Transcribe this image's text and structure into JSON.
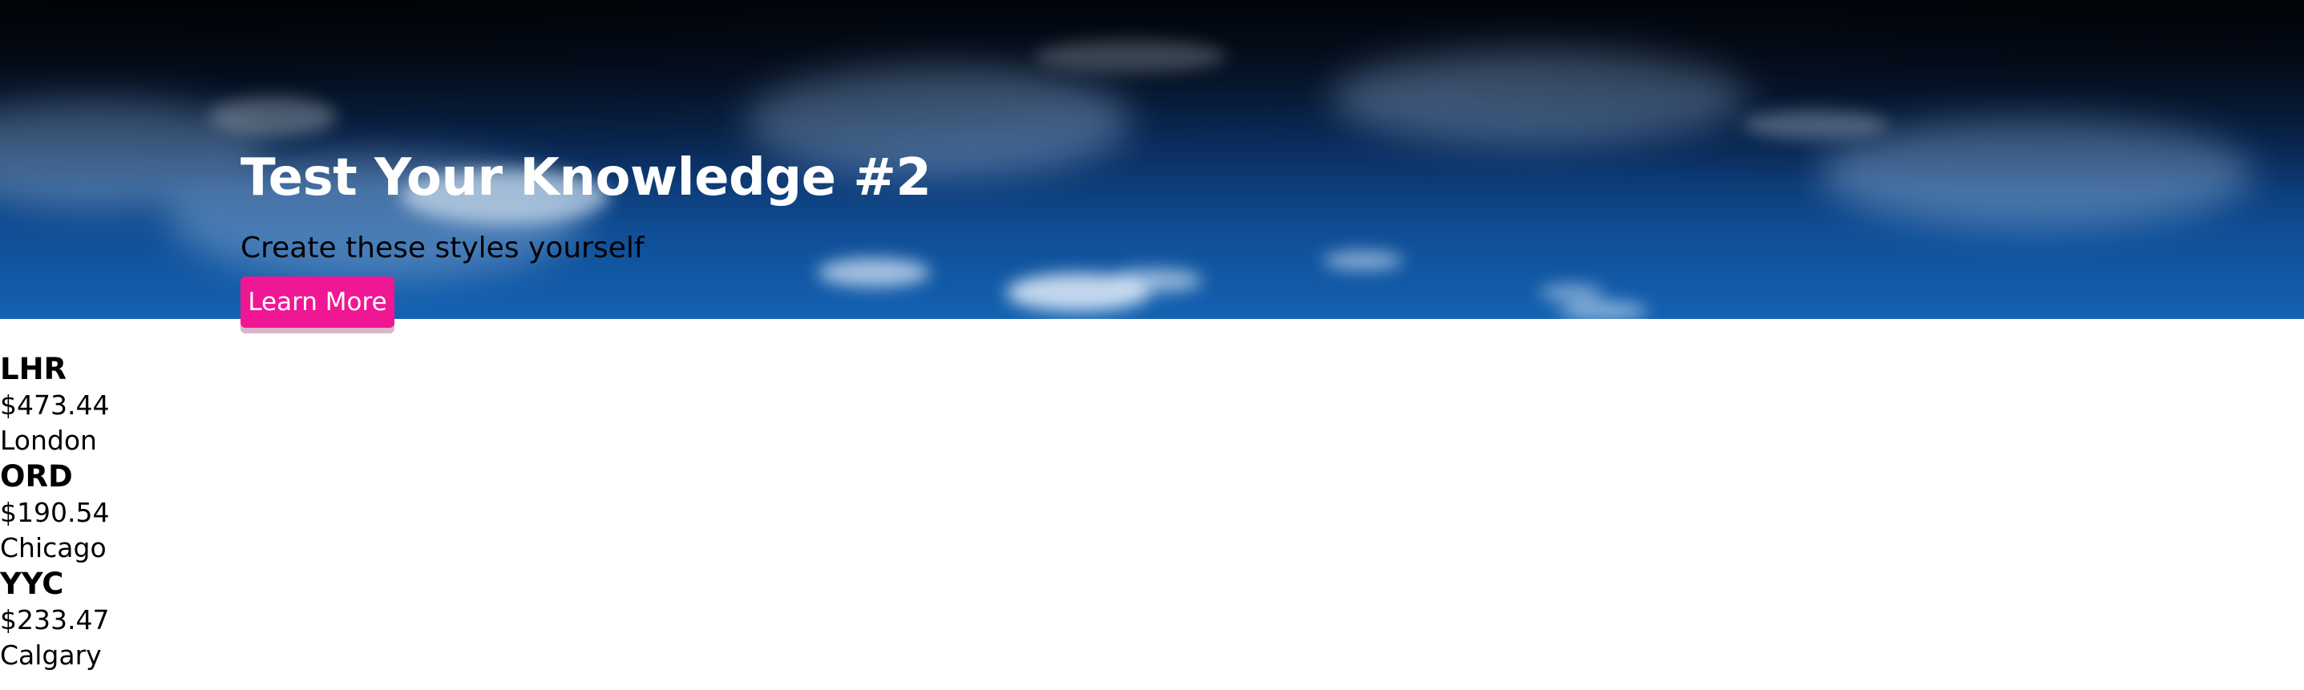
{
  "hero": {
    "title": "Test Your Knowledge #2",
    "subtitle": "Create these styles yourself",
    "button_label": "Learn More",
    "button_color": "#ef1793",
    "background_image": "cloudy-night-sky"
  },
  "airports": [
    {
      "code": "LHR",
      "price": "$473.44",
      "city": "London"
    },
    {
      "code": "ORD",
      "price": "$190.54",
      "city": "Chicago"
    },
    {
      "code": "YYC",
      "price": "$233.47",
      "city": "Calgary"
    }
  ]
}
